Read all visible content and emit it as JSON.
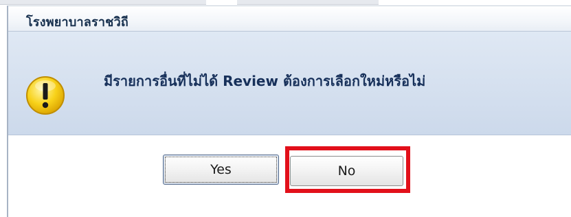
{
  "dialog": {
    "title": "โรงพยาบาลราชวิถี",
    "icon": "warning-exclamation-icon",
    "message": "มีรายการอื่นที่ไม่ได้ Review ต้องการเลือกใหม่หรือไม่",
    "buttons": {
      "yes_label": "Yes",
      "no_label": "No"
    },
    "highlight_color": "#e2101a",
    "accent_color": "#f5c400"
  }
}
